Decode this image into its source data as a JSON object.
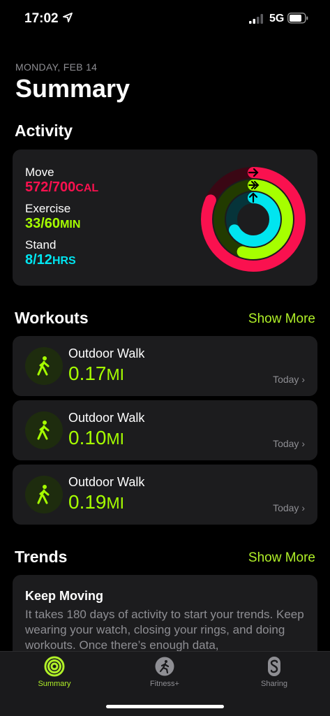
{
  "status_bar": {
    "time": "17:02",
    "network": "5G"
  },
  "header": {
    "date": "MONDAY, FEB 14",
    "title": "Summary"
  },
  "activity": {
    "section_title": "Activity",
    "move": {
      "label": "Move",
      "value": "572/700",
      "unit": "CAL",
      "progress": 0.817
    },
    "exercise": {
      "label": "Exercise",
      "value": "33/60",
      "unit": "MIN",
      "progress": 0.55
    },
    "stand": {
      "label": "Stand",
      "value": "8/12",
      "unit": "HRS",
      "progress": 0.667
    }
  },
  "workouts": {
    "section_title": "Workouts",
    "show_more": "Show More",
    "items": [
      {
        "title": "Outdoor Walk",
        "value": "0.17",
        "unit": "MI",
        "when": "Today"
      },
      {
        "title": "Outdoor Walk",
        "value": "0.10",
        "unit": "MI",
        "when": "Today"
      },
      {
        "title": "Outdoor Walk",
        "value": "0.19",
        "unit": "MI",
        "when": "Today"
      }
    ]
  },
  "trends": {
    "section_title": "Trends",
    "show_more": "Show More",
    "card_title": "Keep Moving",
    "card_text": "It takes 180 days of activity to start your trends. Keep wearing your watch, closing your rings, and doing workouts. Once there’s enough data,"
  },
  "tab_bar": {
    "tabs": [
      {
        "label": "Summary",
        "icon": "activity-rings-icon",
        "active": true
      },
      {
        "label": "Fitness+",
        "icon": "runner-icon",
        "active": false
      },
      {
        "label": "Sharing",
        "icon": "sharing-icon",
        "active": false
      }
    ]
  },
  "colors": {
    "move": "#fa114f",
    "exercise": "#a6ff00",
    "stand": "#00e5f0",
    "accent": "#b0f028"
  }
}
